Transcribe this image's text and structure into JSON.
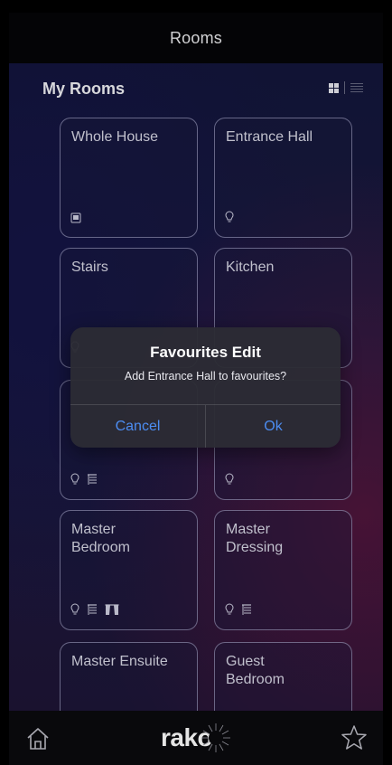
{
  "header": {
    "title": "Rooms"
  },
  "section": {
    "title": "My Rooms"
  },
  "rooms": [
    {
      "name": "Whole House",
      "icons": [
        "tablet-icon"
      ]
    },
    {
      "name": "Entrance Hall",
      "icons": [
        "bulb-icon"
      ]
    },
    {
      "name": "Stairs",
      "icons": [
        "bulb-icon"
      ]
    },
    {
      "name": "Kitchen",
      "icons": []
    },
    {
      "name": "",
      "icons": [
        "bulb-icon",
        "blind-icon"
      ]
    },
    {
      "name": "",
      "icons": [
        "bulb-icon"
      ]
    },
    {
      "name": "Master Bedroom",
      "icons": [
        "bulb-icon",
        "blind-icon",
        "curtain-icon"
      ]
    },
    {
      "name": "Master Dressing",
      "icons": [
        "bulb-icon",
        "blind-icon"
      ]
    },
    {
      "name": "Master Ensuite",
      "icons": []
    },
    {
      "name": "Guest Bedroom",
      "icons": []
    }
  ],
  "dialog": {
    "title": "Favourites Edit",
    "message": "Add Entrance Hall to favourites?",
    "cancel_label": "Cancel",
    "ok_label": "Ok"
  },
  "tabbar": {
    "logo_text": "rako",
    "left_icon": "home-icon",
    "right_icon": "star-icon"
  },
  "colors": {
    "accent": "#4c8df2",
    "dialog_bg": "#2c2c34",
    "tile_border": "#bebee1"
  }
}
